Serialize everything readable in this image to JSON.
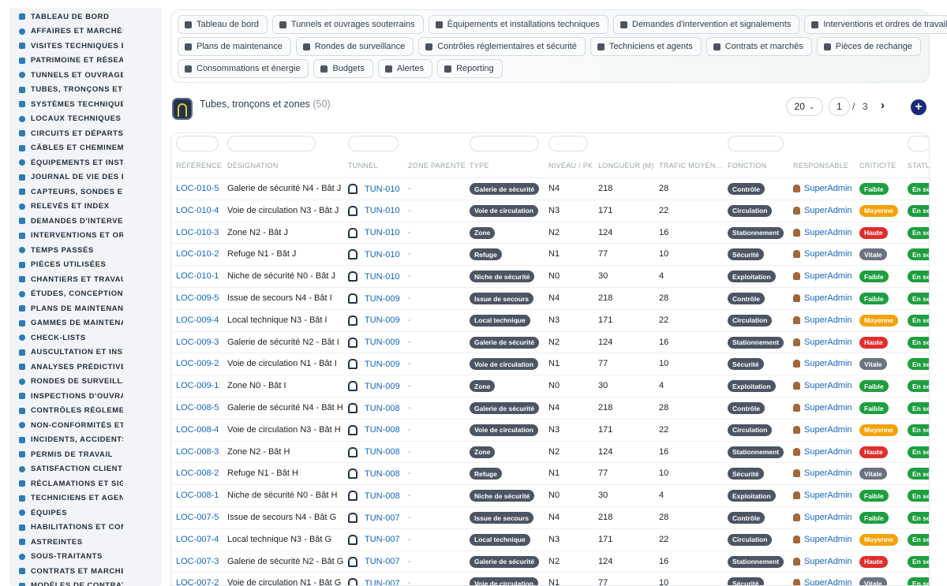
{
  "sidebar": {
    "items": [
      {
        "label": "TABLEAU DE BORD",
        "icon": "dashboard-icon"
      },
      {
        "label": "AFFAIRES ET MARCHÉS",
        "icon": "target-icon"
      },
      {
        "label": "VISITES TECHNIQUES ET",
        "icon": "walk-icon"
      },
      {
        "label": "PATRIMOINE ET RÉSEAUX",
        "icon": "map-pin-icon"
      },
      {
        "label": "TUNNELS ET OUVRAGES",
        "icon": "tunnel-icon"
      },
      {
        "label": "TUBES, TRONÇONS ET ZO",
        "icon": "layers-icon"
      },
      {
        "label": "SYSTÈMES TECHNIQUES",
        "icon": "sitemap-icon"
      },
      {
        "label": "LOCAUX TECHNIQUES ET",
        "icon": "grid-icon"
      },
      {
        "label": "CIRCUITS ET DÉPARTS ÉL",
        "icon": "bolt-icon"
      },
      {
        "label": "CÂBLES ET CHEMINEMENT",
        "icon": "cable-icon"
      },
      {
        "label": "ÉQUIPEMENTS ET INSTAL",
        "icon": "cogs-icon"
      },
      {
        "label": "JOURNAL DE VIE DES ÉQ",
        "icon": "history-icon"
      },
      {
        "label": "CAPTEURS, SONDES ET C",
        "icon": "sensor-icon"
      },
      {
        "label": "RELEVÉS ET INDEX",
        "icon": "clipboard-icon"
      },
      {
        "label": "DEMANDES D'INTERVENT",
        "icon": "question-icon"
      },
      {
        "label": "INTERVENTIONS ET ORDI",
        "icon": "wrench-icon"
      },
      {
        "label": "TEMPS PASSÉS",
        "icon": "clock-icon"
      },
      {
        "label": "PIÈCES UTILISÉES",
        "icon": "box-icon"
      },
      {
        "label": "CHANTIERS ET TRAVAUX",
        "icon": "hammer-icon"
      },
      {
        "label": "ÉTUDES, CONCEPTION ET",
        "icon": "pencil-icon"
      },
      {
        "label": "PLANS DE MAINTENANCE",
        "icon": "calendar-icon"
      },
      {
        "label": "GAMMES DE MAINTENAN",
        "icon": "list-icon"
      },
      {
        "label": "CHECK-LISTS",
        "icon": "checklist-icon"
      },
      {
        "label": "AUSCULTATION ET INSTR",
        "icon": "microscope-icon"
      },
      {
        "label": "ANALYSES PRÉDICTIVES",
        "icon": "chart-icon"
      },
      {
        "label": "RONDES DE SURVEILLAN",
        "icon": "route-icon"
      },
      {
        "label": "INSPECTIONS D'OUVRAG",
        "icon": "search-icon"
      },
      {
        "label": "CONTRÔLES RÉGLEMENT",
        "icon": "file-check-icon"
      },
      {
        "label": "NON-CONFORMITÉS ET A",
        "icon": "warning-icon"
      },
      {
        "label": "INCIDENTS, ACCIDENTS E",
        "icon": "alert-icon"
      },
      {
        "label": "PERMIS DE TRAVAIL",
        "icon": "permit-icon"
      },
      {
        "label": "SATISFACTION CLIENT",
        "icon": "smile-icon"
      },
      {
        "label": "RÉCLAMATIONS ET SIGNA",
        "icon": "comment-icon"
      },
      {
        "label": "TECHNICIENS ET AGENTS",
        "icon": "helmet-icon"
      },
      {
        "label": "ÉQUIPES",
        "icon": "users-icon"
      },
      {
        "label": "HABILITATIONS ET COMP",
        "icon": "certificate-icon"
      },
      {
        "label": "ASTREINTES",
        "icon": "phone-icon"
      },
      {
        "label": "SOUS-TRAITANTS",
        "icon": "handshake-icon"
      },
      {
        "label": "CONTRATS ET MARCHÉS",
        "icon": "contract-icon"
      },
      {
        "label": "MODÈLES DE CONTRATS",
        "icon": "template-icon"
      }
    ]
  },
  "topnav": {
    "rows": [
      [
        {
          "label": "Tableau de bord",
          "icon": "dashboard-icon"
        },
        {
          "label": "Tunnels et ouvrages souterrains",
          "icon": "building-icon"
        },
        {
          "label": "Équipements et installations techniques",
          "icon": "cogs-icon"
        },
        {
          "label": "Demandes d'intervention et signalements",
          "icon": "question-icon"
        },
        {
          "label": "Interventions et ordres de travail",
          "icon": "clipboard-icon"
        }
      ],
      [
        {
          "label": "Plans de maintenance",
          "icon": "calendar-icon"
        },
        {
          "label": "Rondes de surveillance",
          "icon": "route-icon"
        },
        {
          "label": "Contrôles réglementaires et sécurité",
          "icon": "file-check-icon"
        },
        {
          "label": "Techniciens et agents",
          "icon": "helmet-icon"
        },
        {
          "label": "Contrats et marchés",
          "icon": "contract-icon"
        },
        {
          "label": "Pièces de rechange",
          "icon": "sitemap-icon"
        }
      ],
      [
        {
          "label": "Consommations et énergie",
          "icon": "bolt-icon"
        },
        {
          "label": "Budgets",
          "icon": "money-icon"
        },
        {
          "label": "Alertes",
          "icon": "bell-icon"
        },
        {
          "label": "Reporting",
          "icon": "pie-chart-icon"
        }
      ]
    ]
  },
  "header": {
    "title": "Tubes, tronçons et zones",
    "count": "(50)",
    "per_page": "20",
    "page": "1",
    "page_sep": "/",
    "total_pages": "3",
    "next": "›",
    "add": "+"
  },
  "table": {
    "columns": [
      "RÉFÉRENCE",
      "DÉSIGNATION",
      "TUNNEL",
      "ZONE PARENTE",
      "TYPE",
      "NIVEAU / PK",
      "LONGUEUR (M)",
      "TRAFIC MOYEN...",
      "FONCTION",
      "RESPONSABLE",
      "CRITICITÉ",
      "STATUT"
    ],
    "rows": [
      {
        "ref": "LOC-010-5",
        "name": "Galerie de sécurité N4 - Bât J",
        "tunnel": "TUN-010",
        "parent": "-",
        "type": "Galerie de sécurité",
        "level": "N4",
        "length": "218",
        "traffic": "28",
        "func": "Contrôle",
        "resp": "SuperAdmin",
        "crit": "Faible",
        "status": "En service"
      },
      {
        "ref": "LOC-010-4",
        "name": "Voie de circulation N3 - Bât J",
        "tunnel": "TUN-010",
        "parent": "-",
        "type": "Voie de circulation",
        "level": "N3",
        "length": "171",
        "traffic": "22",
        "func": "Circulation",
        "resp": "SuperAdmin",
        "crit": "Moyenne",
        "status": "En service"
      },
      {
        "ref": "LOC-010-3",
        "name": "Zone N2 - Bât J",
        "tunnel": "TUN-010",
        "parent": "-",
        "type": "Zone",
        "level": "N2",
        "length": "124",
        "traffic": "16",
        "func": "Stationnement",
        "resp": "SuperAdmin",
        "crit": "Haute",
        "status": "En service"
      },
      {
        "ref": "LOC-010-2",
        "name": "Refuge N1 - Bât J",
        "tunnel": "TUN-010",
        "parent": "-",
        "type": "Refuge",
        "level": "N1",
        "length": "77",
        "traffic": "10",
        "func": "Sécurité",
        "resp": "SuperAdmin",
        "crit": "Vitale",
        "status": "En service"
      },
      {
        "ref": "LOC-010-1",
        "name": "Niche de sécurité N0 - Bât J",
        "tunnel": "TUN-010",
        "parent": "-",
        "type": "Niche de sécurité",
        "level": "N0",
        "length": "30",
        "traffic": "4",
        "func": "Exploitation",
        "resp": "SuperAdmin",
        "crit": "Faible",
        "status": "En service"
      },
      {
        "ref": "LOC-009-5",
        "name": "Issue de secours N4 - Bât I",
        "tunnel": "TUN-009",
        "parent": "-",
        "type": "Issue de secours",
        "level": "N4",
        "length": "218",
        "traffic": "28",
        "func": "Contrôle",
        "resp": "SuperAdmin",
        "crit": "Faible",
        "status": "En service"
      },
      {
        "ref": "LOC-009-4",
        "name": "Local technique N3 - Bât I",
        "tunnel": "TUN-009",
        "parent": "-",
        "type": "Local technique",
        "level": "N3",
        "length": "171",
        "traffic": "22",
        "func": "Circulation",
        "resp": "SuperAdmin",
        "crit": "Moyenne",
        "status": "En service"
      },
      {
        "ref": "LOC-009-3",
        "name": "Galerie de sécurité N2 - Bât I",
        "tunnel": "TUN-009",
        "parent": "-",
        "type": "Galerie de sécurité",
        "level": "N2",
        "length": "124",
        "traffic": "16",
        "func": "Stationnement",
        "resp": "SuperAdmin",
        "crit": "Haute",
        "status": "En service"
      },
      {
        "ref": "LOC-009-2",
        "name": "Voie de circulation N1 - Bât I",
        "tunnel": "TUN-009",
        "parent": "-",
        "type": "Voie de circulation",
        "level": "N1",
        "length": "77",
        "traffic": "10",
        "func": "Sécurité",
        "resp": "SuperAdmin",
        "crit": "Vitale",
        "status": "En service"
      },
      {
        "ref": "LOC-009-1",
        "name": "Zone N0 - Bât I",
        "tunnel": "TUN-009",
        "parent": "-",
        "type": "Zone",
        "level": "N0",
        "length": "30",
        "traffic": "4",
        "func": "Exploitation",
        "resp": "SuperAdmin",
        "crit": "Faible",
        "status": "En service"
      },
      {
        "ref": "LOC-008-5",
        "name": "Galerie de sécurité N4 - Bât H",
        "tunnel": "TUN-008",
        "parent": "-",
        "type": "Galerie de sécurité",
        "level": "N4",
        "length": "218",
        "traffic": "28",
        "func": "Contrôle",
        "resp": "SuperAdmin",
        "crit": "Faible",
        "status": "En service"
      },
      {
        "ref": "LOC-008-4",
        "name": "Voie de circulation N3 - Bât H",
        "tunnel": "TUN-008",
        "parent": "-",
        "type": "Voie de circulation",
        "level": "N3",
        "length": "171",
        "traffic": "22",
        "func": "Circulation",
        "resp": "SuperAdmin",
        "crit": "Moyenne",
        "status": "En service"
      },
      {
        "ref": "LOC-008-3",
        "name": "Zone N2 - Bât H",
        "tunnel": "TUN-008",
        "parent": "-",
        "type": "Zone",
        "level": "N2",
        "length": "124",
        "traffic": "16",
        "func": "Stationnement",
        "resp": "SuperAdmin",
        "crit": "Haute",
        "status": "En service"
      },
      {
        "ref": "LOC-008-2",
        "name": "Refuge N1 - Bât H",
        "tunnel": "TUN-008",
        "parent": "-",
        "type": "Refuge",
        "level": "N1",
        "length": "77",
        "traffic": "10",
        "func": "Sécurité",
        "resp": "SuperAdmin",
        "crit": "Vitale",
        "status": "En service"
      },
      {
        "ref": "LOC-008-1",
        "name": "Niche de sécurité N0 - Bât H",
        "tunnel": "TUN-008",
        "parent": "-",
        "type": "Niche de sécurité",
        "level": "N0",
        "length": "30",
        "traffic": "4",
        "func": "Exploitation",
        "resp": "SuperAdmin",
        "crit": "Faible",
        "status": "En service"
      },
      {
        "ref": "LOC-007-5",
        "name": "Issue de secours N4 - Bât G",
        "tunnel": "TUN-007",
        "parent": "-",
        "type": "Issue de secours",
        "level": "N4",
        "length": "218",
        "traffic": "28",
        "func": "Contrôle",
        "resp": "SuperAdmin",
        "crit": "Faible",
        "status": "En service"
      },
      {
        "ref": "LOC-007-4",
        "name": "Local technique N3 - Bât G",
        "tunnel": "TUN-007",
        "parent": "-",
        "type": "Local technique",
        "level": "N3",
        "length": "171",
        "traffic": "22",
        "func": "Circulation",
        "resp": "SuperAdmin",
        "crit": "Moyenne",
        "status": "En service"
      },
      {
        "ref": "LOC-007-3",
        "name": "Galerie de sécurité N2 - Bât G",
        "tunnel": "TUN-007",
        "parent": "-",
        "type": "Galerie de sécurité",
        "level": "N2",
        "length": "124",
        "traffic": "16",
        "func": "Stationnement",
        "resp": "SuperAdmin",
        "crit": "Haute",
        "status": "En service"
      },
      {
        "ref": "LOC-007-2",
        "name": "Voie de circulation N1 - Bât G",
        "tunnel": "TUN-007",
        "parent": "-",
        "type": "Voie de circulation",
        "level": "N1",
        "length": "77",
        "traffic": "10",
        "func": "Sécurité",
        "resp": "SuperAdmin",
        "crit": "Vitale",
        "status": "En service"
      }
    ]
  },
  "colors": {
    "sidebar_icon": "#2c7db5",
    "link": "#1565c0",
    "pill_gray": "#4b5563",
    "crit_faible": "#1e9e3f",
    "crit_moyenne": "#f4a20b",
    "crit_haute": "#e02d2d",
    "crit_vitale": "#6b7280",
    "status_en_service": "#1e9e3f",
    "add_button": "#1a2a7a"
  }
}
